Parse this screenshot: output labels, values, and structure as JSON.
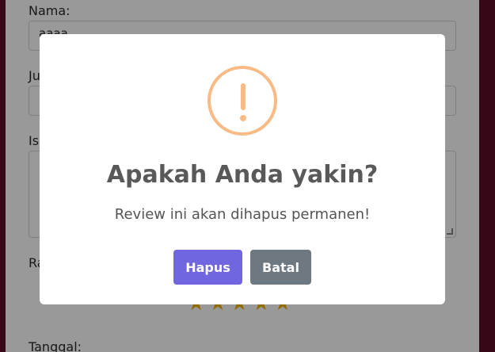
{
  "form": {
    "name_label": "Nama:",
    "name_value": "aaaa",
    "title_label": "Judul:",
    "content_label": "Isi:",
    "rating_label": "Rating:",
    "date_label": "Tanggal:",
    "rating_stars": 5
  },
  "modal": {
    "icon": "warning-icon",
    "icon_color": "#f8bb86",
    "title": "Apakah Anda yakin?",
    "text": "Review ini akan dihapus permanen!",
    "confirm_label": "Hapus",
    "cancel_label": "Batal",
    "confirm_color": "#7066e0",
    "cancel_color": "#6e7881"
  }
}
